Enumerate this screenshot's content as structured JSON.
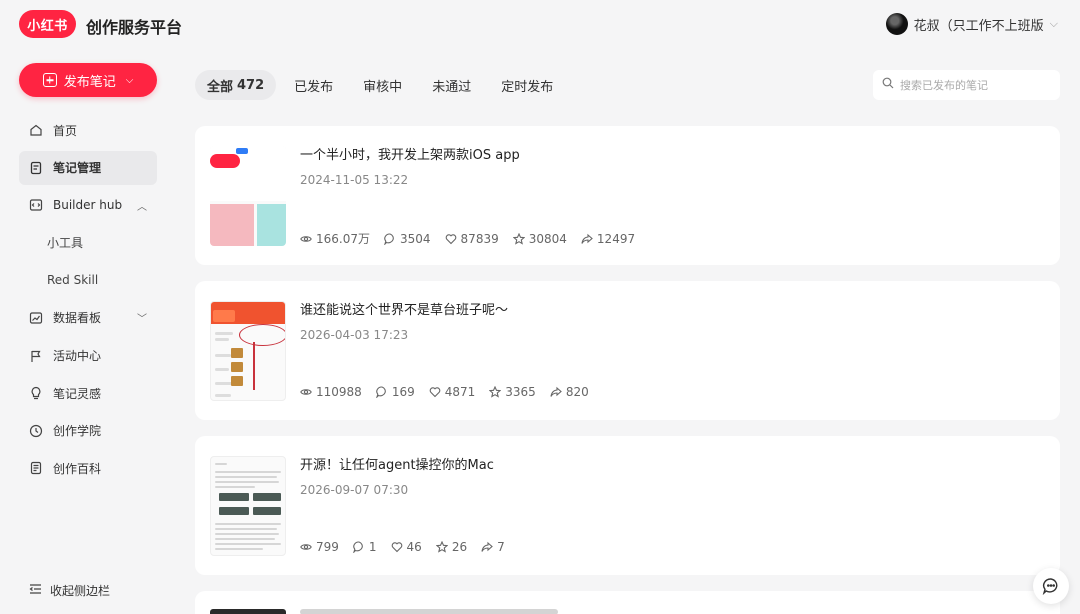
{
  "header": {
    "logo_text": "小红书",
    "platform_title": "创作服务平台",
    "user_name": "花叔（只工作不上班版"
  },
  "sidebar": {
    "publish_label": "发布笔记",
    "items": [
      {
        "label": "首页",
        "icon": "home-icon"
      },
      {
        "label": "笔记管理",
        "icon": "note-icon",
        "active": true
      },
      {
        "label": "Builder hub",
        "icon": "code-icon",
        "expanded": true
      },
      {
        "label": "小工具",
        "sub": true
      },
      {
        "label": "Red Skill",
        "sub": true
      },
      {
        "label": "数据看板",
        "icon": "chart-icon",
        "collapsed": true
      },
      {
        "label": "活动中心",
        "icon": "flag-icon"
      },
      {
        "label": "笔记灵感",
        "icon": "bulb-icon"
      },
      {
        "label": "创作学院",
        "icon": "academy-icon"
      },
      {
        "label": "创作百科",
        "icon": "book-icon"
      }
    ],
    "collapse_label": "收起侧边栏"
  },
  "tabs": [
    {
      "label": "全部",
      "count": "472",
      "active": true
    },
    {
      "label": "已发布"
    },
    {
      "label": "审核中"
    },
    {
      "label": "未通过"
    },
    {
      "label": "定时发布"
    }
  ],
  "search": {
    "placeholder": "搜索已发布的笔记"
  },
  "notes": [
    {
      "title": "一个半小时，我开发上架两款iOS app",
      "date": "2024-11-05 13:22",
      "views": "166.07万",
      "comments": "3504",
      "likes": "87839",
      "collects": "30804",
      "shares": "12497"
    },
    {
      "title": "谁还能说这个世界不是草台班子呢～",
      "date": "2026-04-03 17:23",
      "views": "110988",
      "comments": "169",
      "likes": "4871",
      "collects": "3365",
      "shares": "820"
    },
    {
      "title": "开源！让任何agent操控你的Mac",
      "date": "2026-09-07 07:30",
      "views": "799",
      "comments": "1",
      "likes": "46",
      "collects": "26",
      "shares": "7"
    }
  ],
  "colors": {
    "brand": "#ff2442",
    "background": "#f5f5f6",
    "card": "#ffffff"
  }
}
